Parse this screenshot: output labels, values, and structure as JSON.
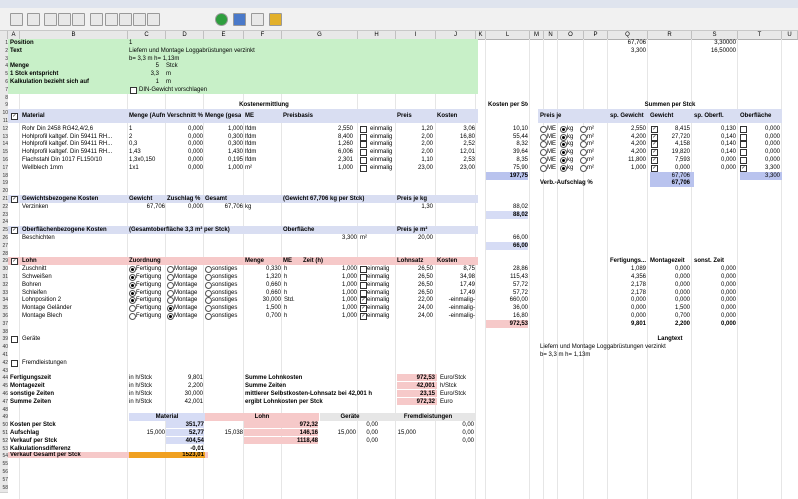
{
  "toolbar": {
    "icons": [
      "print-icon",
      "copy-icon",
      "cut-icon",
      "paste-icon",
      "undo-icon",
      "redo-icon",
      "save-icon",
      "grid-icon",
      "table-icon",
      "format-icon",
      "refresh-icon",
      "calc-icon",
      "tools-icon",
      "color-icon"
    ]
  },
  "columns": [
    "A",
    "B",
    "C",
    "D",
    "E",
    "F",
    "G",
    "H",
    "I",
    "J",
    "K",
    "L",
    "M",
    "N",
    "O",
    "P",
    "Q",
    "R",
    "S",
    "T",
    "U"
  ],
  "header": {
    "position_label": "Position",
    "position_value": "1",
    "text_label": "Text",
    "text_value": "Liefern und Montage Loggabrüstungen verzinkt",
    "dims": "b= 3,3 m h= 1,13m",
    "menge_label": "Menge",
    "menge_value": "5",
    "menge_unit": "Stck",
    "stck_label": "1 Stck entspricht",
    "stck_value": "3,3",
    "stck_unit": "m",
    "kalk_label": "Kalkulation bezieht sich auf",
    "kalk_value": "1",
    "kalk_unit": "m",
    "din_label": "DIN-Gewicht vorschlagen"
  },
  "top_right": {
    "r1": "67,706",
    "r1t": "3,30000",
    "r2": "3,300",
    "r2t": "16,50000"
  },
  "material": {
    "section_title": "Kostenermittlung",
    "headers": [
      "Material",
      "Menge (Aufmaß)",
      "Verschnitt %",
      "Menge (gesamt)",
      "ME",
      "Preisbasis",
      "Preis",
      "Kosten"
    ],
    "rows": [
      [
        "Rohr Din 2458 RG42,4/2,6",
        "1",
        "0,000",
        "1,000",
        "lfdm",
        "2,550",
        "einmalig",
        "1,20",
        "3,06"
      ],
      [
        "Hohlprofil kaltgef. Din 59411 RH...",
        "2",
        "0,000",
        "0,300",
        "lfdm",
        "8,400",
        "einmalig",
        "2,00",
        "16,80"
      ],
      [
        "Hohlprofil kaltgef. Din 59411 RH...",
        "0,3",
        "0,000",
        "0,300",
        "lfdm",
        "1,260",
        "einmalig",
        "2,00",
        "2,52"
      ],
      [
        "Hohlprofil kaltgef. Din 59411 RH...",
        "1,43",
        "0,000",
        "1,430",
        "lfdm",
        "6,006",
        "einmalig",
        "2,00",
        "12,01"
      ],
      [
        "Flachstahl Din 1017 FL150/10",
        "1,3x0,150",
        "0,000",
        "0,195",
        "lfdm",
        "2,301",
        "einmalig",
        "1,10",
        "2,53"
      ],
      [
        "Wellblech 1mm",
        "1x1",
        "0,000",
        "1,000",
        "m²",
        "1,000",
        "einmalig",
        "23,00",
        "23,00"
      ]
    ],
    "kosten_pro_stck_label": "Kosten per Stck",
    "kosten_pro_stck": [
      "10,10",
      "55,44",
      "8,32",
      "39,64",
      "8,35",
      "75,90",
      "197,75"
    ],
    "summen_title": "Summen per Stck",
    "summen_headers": [
      "Preis je",
      "sp. Gewicht",
      "Gewicht",
      "sp. Oberfl.",
      "Oberfläche"
    ],
    "summen_rows": [
      [
        "2,550",
        "8,415",
        "0,130",
        "0,000"
      ],
      [
        "4,200",
        "27,720",
        "0,140",
        "0,000"
      ],
      [
        "4,200",
        "4,158",
        "0,140",
        "0,000"
      ],
      [
        "4,200",
        "19,820",
        "0,140",
        "0,000"
      ],
      [
        "11,800",
        "7,593",
        "0,000",
        "0,000"
      ],
      [
        "1,000",
        "0,000",
        "0,000",
        "3,300"
      ]
    ],
    "summen_total_gewicht": "67,706",
    "summen_total_oberfl": "3,300",
    "verb_label": "Verb.-Aufschlag %",
    "verb_value": "67,706",
    "me_label": "ME",
    "kg_label": "kg",
    "m2_label": "m²"
  },
  "gewicht": {
    "title": "Gewichtsbezogene Kosten",
    "headers": [
      "Gewicht",
      "Zuschlag %",
      "Gesamt",
      "(Gewicht 67,706 kg per Stck)",
      "Preis je kg"
    ],
    "row": [
      "Verzinken",
      "67,706",
      "0,000",
      "67,706",
      "kg",
      "1,30"
    ],
    "m_values": [
      "88,02",
      "88,02"
    ]
  },
  "oberflaeche": {
    "title": "Oberflächenbezogene Kosten",
    "subtitle": "(Gesamtoberfläche 3,3 m² per Stck)",
    "col_header": "Oberfläche",
    "price_header": "Preis je m²",
    "row": [
      "Beschichten",
      "3,300",
      "m²",
      "20,00"
    ],
    "m_values": [
      "66,00",
      "66,00"
    ]
  },
  "lohn": {
    "headers": [
      "Lohn",
      "Zuordnung",
      "Menge",
      "ME",
      "Zeit (h)",
      "Lohnsatz",
      "Kosten"
    ],
    "opt_labels": [
      "Fertigung",
      "Montage",
      "sonstiges"
    ],
    "rows": [
      [
        "Zuschnitt",
        "0,330",
        "h",
        "1,000",
        "einmalig",
        "26,50",
        "8,75",
        "28,86"
      ],
      [
        "Schweißen",
        "1,320",
        "h",
        "1,000",
        "einmalig",
        "26,50",
        "34,98",
        "115,43"
      ],
      [
        "Bohren",
        "0,660",
        "h",
        "1,000",
        "einmalig",
        "26,50",
        "17,49",
        "57,72"
      ],
      [
        "Schleifen",
        "0,660",
        "h",
        "1,000",
        "einmalig",
        "26,50",
        "17,49",
        "57,72"
      ],
      [
        "Lohnposition 2",
        "30,000",
        "Std.",
        "1,000",
        "einmalig",
        "22,00",
        "-einmalig-",
        "660,00"
      ],
      [
        "Montage Geländer",
        "1,500",
        "h",
        "1,000",
        "einmalig",
        "24,00",
        "-einmalig-",
        "36,00"
      ],
      [
        "Montage Blech",
        "0,700",
        "h",
        "1,000",
        "einmalig",
        "24,00",
        "-einmalig-",
        "16,80"
      ]
    ],
    "m_total": "972,53",
    "right_headers": [
      "Fertigungs...",
      "Montagezeit",
      "sonst. Zeit"
    ],
    "right_rows": [
      [
        "1,089",
        "0,000",
        "0,000"
      ],
      [
        "4,356",
        "0,000",
        "0,000"
      ],
      [
        "2,178",
        "0,000",
        "0,000"
      ],
      [
        "2,178",
        "0,000",
        "0,000"
      ],
      [
        "0,000",
        "0,000",
        "0,000"
      ],
      [
        "0,000",
        "1,500",
        "0,000"
      ],
      [
        "0,000",
        "0,700",
        "0,000"
      ]
    ],
    "right_total": [
      "9,801",
      "2,200",
      "0,000"
    ]
  },
  "geraete_label": "Geräte",
  "fremd_label": "Fremdleistungen",
  "langtext": {
    "title": "Langtext",
    "line1": "Liefern und  Montage Loggabrüstungen verzinkt",
    "line2": "b= 3,3 m h= 1,13m"
  },
  "zeiten": {
    "rows": [
      [
        "Fertigungszeit",
        "in h/Stck",
        "9,801"
      ],
      [
        "Montagezeit",
        "in h/Stck",
        "2,200"
      ],
      [
        "sonstige Zeiten",
        "in h/Stck",
        "30,000"
      ],
      [
        "Summe Zeiten",
        "in h/Stck",
        "42,001"
      ]
    ],
    "right": [
      [
        "Summe Lohnkosten",
        "972,53",
        "Euro/Stck"
      ],
      [
        "Summe Zeiten",
        "42,001",
        "h/Stck"
      ],
      [
        "mittlerer Selbstkosten-Lohnsatz bei 42,001 h",
        "23,15",
        "Euro/Stck"
      ],
      [
        "ergibt Lohnkosten per Stck",
        "972,32",
        "Euro"
      ]
    ]
  },
  "summary": {
    "col_headers": [
      "Material",
      "Lohn",
      "Geräte",
      "Fremdleistungen"
    ],
    "rows": [
      [
        "Kosten per Stck",
        "",
        "351,77",
        "",
        "972,32",
        "",
        "0,00",
        "",
        "0,00"
      ],
      [
        "Aufschlag",
        "15,000",
        "52,77",
        "15,038",
        "146,16",
        "15,000",
        "0,00",
        "15,000",
        "0,00"
      ],
      [
        "Verkauf per Stck",
        "",
        "404,54",
        "",
        "1118,48",
        "",
        "0,00",
        "",
        "0,00"
      ]
    ],
    "kalk_label": "Kalkulationsdifferenz",
    "kalk_value": "-0,01",
    "vk_label": "Verkauf Gesamt per Stck",
    "vk_value": "1523,01"
  }
}
